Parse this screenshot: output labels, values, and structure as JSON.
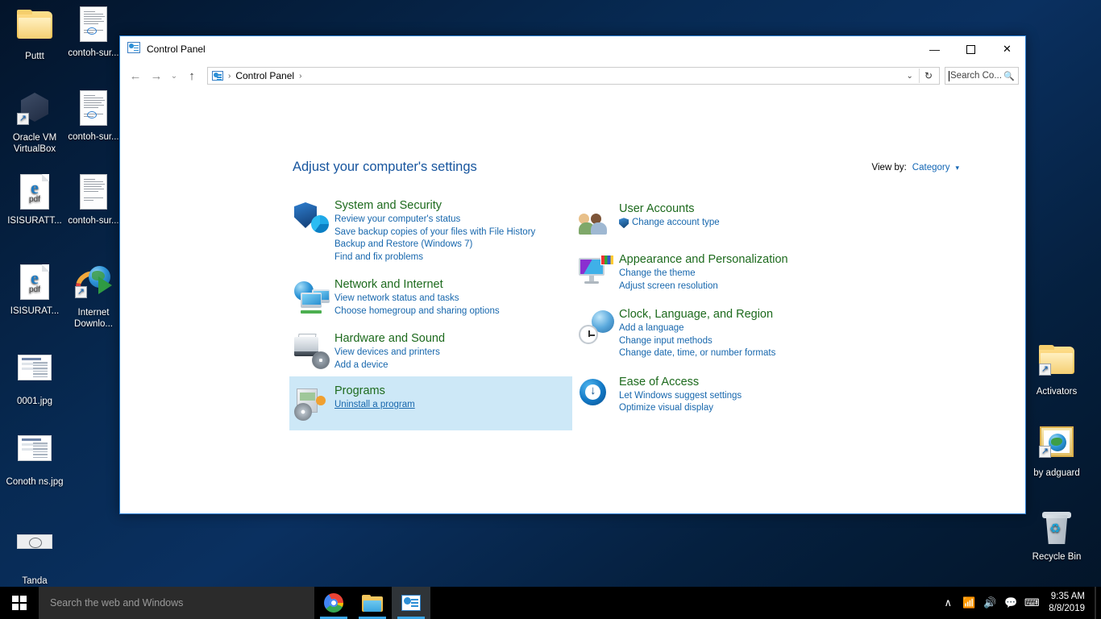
{
  "desktop": {
    "icons": [
      {
        "name": "Puttt",
        "label": "Puttt",
        "type": "folder"
      },
      {
        "name": "contoh-surat-1",
        "label": "contoh-sur...",
        "type": "document"
      },
      {
        "name": "oracle-vm-virtualbox",
        "label": "Oracle VM VirtualBox",
        "type": "virtualbox"
      },
      {
        "name": "contoh-surat-2",
        "label": "contoh-sur...",
        "type": "document"
      },
      {
        "name": "isisuratt-pdf",
        "label": "ISISURATT...",
        "type": "pdf"
      },
      {
        "name": "contoh-surat-3",
        "label": "contoh-sur...",
        "type": "document"
      },
      {
        "name": "isisurat-pdf",
        "label": "ISISURAT...",
        "type": "pdf"
      },
      {
        "name": "internet-download-manager",
        "label": "Internet Downlo...",
        "type": "idm"
      },
      {
        "name": "0001-jpg",
        "label": "0001.jpg",
        "type": "image"
      },
      {
        "name": "conothns-jpg",
        "label": "Conoth ns.jpg",
        "type": "image"
      },
      {
        "name": "tanda-tangan-jpg",
        "label": "Tanda tangan.jpg",
        "type": "signature"
      },
      {
        "name": "activators",
        "label": "Activators",
        "type": "folder-shortcut"
      },
      {
        "name": "by-adguard",
        "label": "by adguard",
        "type": "adguard"
      },
      {
        "name": "recycle-bin",
        "label": "Recycle Bin",
        "type": "recycle"
      }
    ]
  },
  "window": {
    "title": "Control Panel",
    "icon": "control-panel-icon",
    "controls": {
      "minimize": "—",
      "maximize": "☐",
      "close": "✕"
    },
    "nav": {
      "back": "←",
      "forward": "→",
      "recent": "⌄",
      "up": "↑"
    },
    "address": {
      "crumbs": [
        "Control Panel"
      ],
      "separator": "›",
      "dropdown": "⌄",
      "refresh": "↻"
    },
    "search": {
      "placeholder": "Search Co...",
      "icon": "search-icon"
    }
  },
  "main": {
    "heading": "Adjust your computer's settings",
    "view_by": {
      "label": "View by:",
      "value": "Category",
      "arrow": "▾"
    },
    "categories_left": [
      {
        "id": "system-and-security",
        "title": "System and Security",
        "icon": "shield-pie-icon",
        "links": [
          "Review your computer's status",
          "Save backup copies of your files with File History",
          "Backup and Restore (Windows 7)",
          "Find and fix problems"
        ],
        "highlighted": false
      },
      {
        "id": "network-and-internet",
        "title": "Network and Internet",
        "icon": "globe-monitors-icon",
        "links": [
          "View network status and tasks",
          "Choose homegroup and sharing options"
        ],
        "highlighted": false
      },
      {
        "id": "hardware-and-sound",
        "title": "Hardware and Sound",
        "icon": "printer-disc-icon",
        "links": [
          "View devices and printers",
          "Add a device"
        ],
        "highlighted": false
      },
      {
        "id": "programs",
        "title": "Programs",
        "icon": "program-box-disc-icon",
        "links": [
          "Uninstall a program"
        ],
        "highlighted": true
      }
    ],
    "categories_right": [
      {
        "id": "user-accounts",
        "title": "User Accounts",
        "icon": "two-people-icon",
        "links": [
          "Change account type"
        ],
        "link_shield": true
      },
      {
        "id": "appearance-and-personalization",
        "title": "Appearance and Personalization",
        "icon": "monitor-palette-icon",
        "links": [
          "Change the theme",
          "Adjust screen resolution"
        ]
      },
      {
        "id": "clock-language-and-region",
        "title": "Clock, Language, and Region",
        "icon": "globe-clock-icon",
        "links": [
          "Add a language",
          "Change input methods",
          "Change date, time, or number formats"
        ]
      },
      {
        "id": "ease-of-access",
        "title": "Ease of Access",
        "icon": "accessibility-clock-icon",
        "links": [
          "Let Windows suggest settings",
          "Optimize visual display"
        ]
      }
    ]
  },
  "taskbar": {
    "start": "windows-logo-icon",
    "search_placeholder": "Search the web and Windows",
    "buttons": [
      {
        "name": "chrome",
        "icon": "chrome-icon",
        "active": false
      },
      {
        "name": "file-explorer",
        "icon": "folder-icon",
        "active": false
      },
      {
        "name": "control-panel",
        "icon": "control-panel-icon",
        "active": true
      }
    ],
    "tray": {
      "overflow": "∧",
      "network": "network-wifi-icon",
      "volume": "speaker-icon",
      "action_center": "action-center-icon",
      "keyboard": "keyboard-icon",
      "time": "9:35 AM",
      "date": "8/8/2019"
    }
  },
  "colors": {
    "accent": "#1767ad",
    "category_title": "#1d6a1d",
    "heading": "#17559e",
    "highlight": "#cde8f7",
    "window_border": "#2a7fd4",
    "taskbar": "#000000"
  }
}
